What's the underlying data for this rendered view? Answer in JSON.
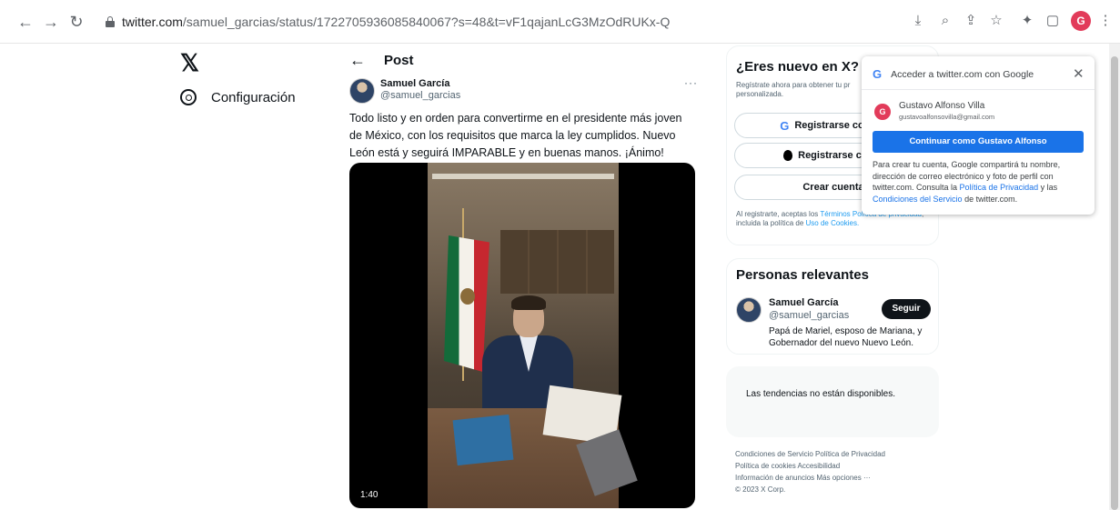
{
  "browser": {
    "url_host": "twitter.com",
    "url_path": "/samuel_garcias/status/1722705936085840067?s=48&t=vF1qajanLcG3MzOdRUKx-Q",
    "profile_initial": "G"
  },
  "left_nav": {
    "logo": "𝕏",
    "settings_label": "Configuración"
  },
  "post": {
    "header_title": "Post",
    "author_name": "Samuel García",
    "author_handle": "@samuel_garcias",
    "more": "···",
    "text": "Todo listo y en orden para convertirme en el presidente más joven de México, con los requisitos que marca la ley cumplidos. Nuevo León está y seguirá IMPARABLE y en buenas manos. ¡Ánimo!",
    "video_time": "1:40"
  },
  "signup": {
    "title": "¿Eres nuevo en X?",
    "desc": "Regístrate ahora para obtener tu pr personalizada.",
    "google_label": "Registrarse con Go",
    "apple_label": "Registrarse con A",
    "create_label": "Crear cuenta",
    "legal_prefix": "Al registrarte, aceptas los ",
    "legal_terms": "Términos",
    "legal_privacy": "Política de privacidad",
    "legal_mid": ", incluida la política de ",
    "legal_cookies": "Uso de Cookies."
  },
  "people": {
    "title": "Personas relevantes",
    "name": "Samuel García",
    "handle": "@samuel_garcias",
    "follow": "Seguir",
    "bio": "Papá de Mariel, esposo de Mariana, y Gobernador del nuevo Nuevo León."
  },
  "trends": {
    "text": "Las tendencias no están disponibles."
  },
  "footer": {
    "line1": "Condiciones de Servicio   Política de Privacidad",
    "line2": "Política de cookies   Accesibilidad",
    "line3": "Información de anuncios   Más opciones ···",
    "line4": "© 2023 X Corp."
  },
  "google_popup": {
    "title": "Acceder a twitter.com con Google",
    "account_initial": "G",
    "account_name": "Gustavo Alfonso Villa",
    "account_email": "gustavoalfonsovilla@gmail.com",
    "continue_label": "Continuar como Gustavo Alfonso",
    "text_before": "Para crear tu cuenta, Google compartirá tu nombre, dirección de correo electrónico y foto de perfil con twitter.com. Consulta la ",
    "privacy_link": "Política de Privacidad",
    "text_mid": " y las ",
    "terms_link": "Condiciones del Servicio",
    "text_after": " de twitter.com."
  }
}
